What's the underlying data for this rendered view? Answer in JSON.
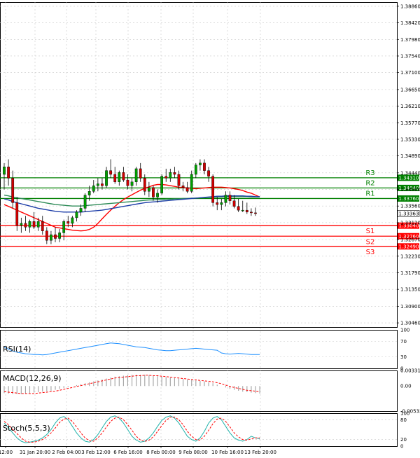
{
  "chart_data": {
    "type": "candlestick",
    "price_axis": {
      "ticks": [
        "1.38860",
        "1.38420",
        "1.37980",
        "1.37540",
        "1.37100",
        "1.36650",
        "1.36210",
        "1.35770",
        "1.35330",
        "1.34890",
        "1.34440",
        "1.34000",
        "1.33560",
        "1.33120",
        "1.32670",
        "1.32230",
        "1.31790",
        "1.31350",
        "1.30900",
        "1.30460"
      ],
      "ylim": [
        1.3035,
        1.3897
      ]
    },
    "time_axis": {
      "ticks": [
        "12:00",
        "31 Jan 20:00",
        "2 Feb 04:00",
        "3 Feb 12:00",
        "6 Feb 16:00",
        "8 Feb 00:00",
        "9 Feb 08:00",
        "10 Feb 16:00",
        "13 Feb 20:00"
      ]
    },
    "candles": [
      [
        1.344,
        1.347,
        1.34,
        1.346
      ],
      [
        1.346,
        1.348,
        1.341,
        1.343
      ],
      [
        1.343,
        1.345,
        1.335,
        1.3365
      ],
      [
        1.3365,
        1.338,
        1.329,
        1.3305
      ],
      [
        1.3305,
        1.3325,
        1.3285,
        1.331
      ],
      [
        1.331,
        1.333,
        1.329,
        1.33
      ],
      [
        1.33,
        1.332,
        1.3285,
        1.3315
      ],
      [
        1.3315,
        1.334,
        1.3295,
        1.33
      ],
      [
        1.33,
        1.3325,
        1.329,
        1.3315
      ],
      [
        1.3315,
        1.333,
        1.328,
        1.329
      ],
      [
        1.329,
        1.33,
        1.3255,
        1.3265
      ],
      [
        1.3265,
        1.329,
        1.3255,
        1.328
      ],
      [
        1.328,
        1.33,
        1.326,
        1.327
      ],
      [
        1.327,
        1.3295,
        1.326,
        1.3285
      ],
      [
        1.3285,
        1.332,
        1.3265,
        1.3315
      ],
      [
        1.3315,
        1.333,
        1.33,
        1.331
      ],
      [
        1.331,
        1.333,
        1.33,
        1.3325
      ],
      [
        1.3325,
        1.3345,
        1.3315,
        1.334
      ],
      [
        1.334,
        1.336,
        1.333,
        1.335
      ],
      [
        1.335,
        1.339,
        1.334,
        1.3385
      ],
      [
        1.3385,
        1.341,
        1.337,
        1.3395
      ],
      [
        1.3395,
        1.3425,
        1.339,
        1.341
      ],
      [
        1.341,
        1.343,
        1.3395,
        1.3415
      ],
      [
        1.3415,
        1.343,
        1.34,
        1.341
      ],
      [
        1.341,
        1.346,
        1.3405,
        1.345
      ],
      [
        1.345,
        1.348,
        1.343,
        1.344
      ],
      [
        1.344,
        1.346,
        1.3415,
        1.342
      ],
      [
        1.342,
        1.345,
        1.341,
        1.3445
      ],
      [
        1.3445,
        1.346,
        1.342,
        1.3425
      ],
      [
        1.3425,
        1.344,
        1.34,
        1.341
      ],
      [
        1.341,
        1.343,
        1.3395,
        1.342
      ],
      [
        1.342,
        1.346,
        1.341,
        1.3455
      ],
      [
        1.3455,
        1.347,
        1.342,
        1.343
      ],
      [
        1.343,
        1.344,
        1.3385,
        1.3395
      ],
      [
        1.3395,
        1.342,
        1.338,
        1.3405
      ],
      [
        1.3405,
        1.341,
        1.337,
        1.338
      ],
      [
        1.338,
        1.34,
        1.3365,
        1.339
      ],
      [
        1.339,
        1.344,
        1.3385,
        1.3435
      ],
      [
        1.3435,
        1.3455,
        1.342,
        1.343
      ],
      [
        1.343,
        1.3455,
        1.342,
        1.3445
      ],
      [
        1.3445,
        1.346,
        1.343,
        1.344
      ],
      [
        1.344,
        1.345,
        1.34,
        1.341
      ],
      [
        1.341,
        1.342,
        1.3395,
        1.3405
      ],
      [
        1.3405,
        1.342,
        1.339,
        1.3395
      ],
      [
        1.3395,
        1.345,
        1.339,
        1.344
      ],
      [
        1.344,
        1.347,
        1.343,
        1.3465
      ],
      [
        1.3465,
        1.348,
        1.345,
        1.347
      ],
      [
        1.347,
        1.348,
        1.344,
        1.345
      ],
      [
        1.345,
        1.346,
        1.342,
        1.3435
      ],
      [
        1.3435,
        1.344,
        1.3355,
        1.3365
      ],
      [
        1.3365,
        1.338,
        1.3345,
        1.336
      ],
      [
        1.336,
        1.3375,
        1.3345,
        1.3365
      ],
      [
        1.3365,
        1.3395,
        1.3355,
        1.3385
      ],
      [
        1.3385,
        1.3395,
        1.336,
        1.337
      ],
      [
        1.337,
        1.3385,
        1.335,
        1.3355
      ],
      [
        1.3355,
        1.3375,
        1.334,
        1.3345
      ],
      [
        1.3345,
        1.337,
        1.334,
        1.3345
      ],
      [
        1.3345,
        1.3365,
        1.3335,
        1.334
      ],
      [
        1.334,
        1.335,
        1.333,
        1.3338
      ],
      [
        1.3338,
        1.3352,
        1.333,
        1.3336
      ]
    ],
    "moving_averages": [
      {
        "color": "#ff0000",
        "values": [
          1.336,
          1.3355,
          1.335,
          1.3345,
          1.334,
          1.3335,
          1.333,
          1.3325,
          1.332,
          1.3315,
          1.331,
          1.3305,
          1.33,
          1.3298,
          1.3296,
          1.3294,
          1.3292,
          1.3291,
          1.329,
          1.3291,
          1.3294,
          1.33,
          1.331,
          1.3322,
          1.3334,
          1.3345,
          1.3355,
          1.3365,
          1.3373,
          1.338,
          1.3386,
          1.3392,
          1.3398,
          1.3403,
          1.3407,
          1.3411,
          1.3413,
          1.3413,
          1.3412,
          1.341,
          1.3408,
          1.3406,
          1.3405,
          1.3404,
          1.3403,
          1.3402,
          1.3403,
          1.3404,
          1.3405,
          1.3406,
          1.3406,
          1.3406,
          1.3405,
          1.3404,
          1.3402,
          1.34,
          1.3397,
          1.3393,
          1.339,
          1.3385,
          1.338
        ]
      },
      {
        "color": "#2e8b57",
        "values": [
          1.3385,
          1.3383,
          1.338,
          1.3378,
          1.3376,
          1.3374,
          1.3372,
          1.337,
          1.3368,
          1.3366,
          1.3364,
          1.3362,
          1.336,
          1.3359,
          1.3358,
          1.3357,
          1.3356,
          1.3356,
          1.3356,
          1.3357,
          1.3358,
          1.3359,
          1.336,
          1.3361,
          1.3362,
          1.3363,
          1.3364,
          1.3365,
          1.3366,
          1.3367,
          1.3368,
          1.3369,
          1.337,
          1.3371,
          1.3372,
          1.3372,
          1.3373,
          1.3373,
          1.3374,
          1.3374,
          1.3375,
          1.3375,
          1.3376,
          1.3376,
          1.3377,
          1.3377,
          1.3378,
          1.3378,
          1.3379,
          1.3379,
          1.338,
          1.338,
          1.3381,
          1.3381,
          1.3381,
          1.3381,
          1.3381,
          1.3381,
          1.338,
          1.338,
          1.338
        ]
      },
      {
        "color": "#1e3ea8",
        "values": [
          1.3375,
          1.3372,
          1.3368,
          1.3365,
          1.3362,
          1.3359,
          1.3356,
          1.3353,
          1.335,
          1.3348,
          1.3346,
          1.3344,
          1.3342,
          1.3341,
          1.334,
          1.334,
          1.334,
          1.334,
          1.334,
          1.3341,
          1.3342,
          1.3343,
          1.3344,
          1.3345,
          1.3347,
          1.3349,
          1.3351,
          1.3353,
          1.3355,
          1.3357,
          1.3359,
          1.3361,
          1.3363,
          1.3365,
          1.3366,
          1.3367,
          1.3368,
          1.3369,
          1.337,
          1.3371,
          1.3372,
          1.3373,
          1.3374,
          1.3375,
          1.3376,
          1.3377,
          1.3378,
          1.3379,
          1.338,
          1.3381,
          1.3382,
          1.3382,
          1.3383,
          1.3383,
          1.3383,
          1.3383,
          1.3383,
          1.3382,
          1.3382,
          1.3381,
          1.3381
        ]
      }
    ],
    "levels": [
      {
        "name": "R3",
        "value": 1.3431,
        "label": "1.34310",
        "color": "#008000"
      },
      {
        "name": "R2",
        "value": 1.3404,
        "label": "1.34040",
        "color": "#008000"
      },
      {
        "name": "R1",
        "value": 1.3376,
        "label": "1.33760",
        "color": "#008000"
      },
      {
        "name": "S1",
        "value": 1.3304,
        "label": "1.33040",
        "color": "#ff0000"
      },
      {
        "name": "S2",
        "value": 1.3276,
        "label": "1.32760",
        "color": "#ff0000"
      },
      {
        "name": "S3",
        "value": 1.3249,
        "label": "1.32490",
        "color": "#ff0000"
      }
    ],
    "current_price": {
      "value": 1.33363,
      "label": "1.33363"
    },
    "rsi": {
      "title": "RSI(14)",
      "ticks": [
        "100",
        "70",
        "30",
        "0"
      ],
      "ylim": [
        0,
        100
      ],
      "color": "#1e90ff",
      "values": [
        55,
        50,
        45,
        42,
        40,
        38,
        37,
        36,
        36,
        35,
        36,
        38,
        40,
        42,
        44,
        46,
        48,
        50,
        52,
        54,
        56,
        58,
        60,
        62,
        64,
        66,
        65,
        64,
        62,
        60,
        58,
        56,
        55,
        54,
        52,
        50,
        48,
        47,
        46,
        46,
        47,
        48,
        49,
        50,
        51,
        52,
        51,
        50,
        49,
        48,
        47,
        40,
        38,
        37,
        38,
        39,
        38,
        37,
        36,
        36,
        36
      ]
    },
    "macd": {
      "title": "MACD(12,26,9)",
      "ticks": [
        "0.003317",
        "0.00",
        "-0.005332"
      ],
      "ylim": [
        -0.005332,
        0.003317
      ],
      "hist_color": "#a0a0a0",
      "signal_color": "#ff0000",
      "histogram": [
        -0.0015,
        -0.0016,
        -0.0017,
        -0.0017,
        -0.0017,
        -0.0016,
        -0.0015,
        -0.0014,
        -0.0013,
        -0.0012,
        -0.0011,
        -0.001,
        -0.0008,
        -0.0006,
        -0.0004,
        -0.0002,
        0.0,
        0.0002,
        0.0004,
        0.0006,
        0.0008,
        0.001,
        0.0012,
        0.0014,
        0.0016,
        0.0018,
        0.002,
        0.0021,
        0.0022,
        0.0023,
        0.0024,
        0.0024,
        0.0024,
        0.0024,
        0.0023,
        0.0022,
        0.0021,
        0.002,
        0.0019,
        0.0018,
        0.0017,
        0.0016,
        0.0015,
        0.0014,
        0.0013,
        0.0012,
        0.0011,
        0.001,
        0.0008,
        0.0006,
        0.0003,
        0.0,
        -0.0003,
        -0.0006,
        -0.0008,
        -0.001,
        -0.0012,
        -0.0013,
        -0.0014,
        -0.0015,
        -0.0016
      ],
      "signal": [
        -0.0012,
        -0.0013,
        -0.0014,
        -0.0015,
        -0.0016,
        -0.0016,
        -0.0016,
        -0.0016,
        -0.0015,
        -0.0014,
        -0.0013,
        -0.0012,
        -0.0011,
        -0.0009,
        -0.0007,
        -0.0005,
        -0.0003,
        -0.0001,
        0.0001,
        0.0003,
        0.0005,
        0.0007,
        0.0009,
        0.0011,
        0.0013,
        0.0015,
        0.0017,
        0.0018,
        0.0019,
        0.002,
        0.0021,
        0.0022,
        0.0022,
        0.0023,
        0.0023,
        0.0022,
        0.0022,
        0.0021,
        0.002,
        0.0019,
        0.0018,
        0.0017,
        0.0016,
        0.0015,
        0.0014,
        0.0013,
        0.0012,
        0.0011,
        0.001,
        0.0009,
        0.0007,
        0.0005,
        0.0002,
        -0.0001,
        -0.0003,
        -0.0005,
        -0.0007,
        -0.0009,
        -0.001,
        -0.0011,
        -0.0012
      ]
    },
    "stoch": {
      "title": "Stoch(5,5,3)",
      "ticks": [
        "100",
        "80",
        "20",
        "0"
      ],
      "ylim": [
        0,
        100
      ],
      "k_color": "#20b2aa",
      "d_color": "#ff0000",
      "k": [
        70,
        55,
        40,
        25,
        15,
        10,
        12,
        15,
        18,
        25,
        35,
        50,
        70,
        85,
        90,
        80,
        60,
        40,
        25,
        15,
        12,
        20,
        35,
        55,
        75,
        88,
        92,
        85,
        70,
        50,
        30,
        18,
        12,
        15,
        25,
        40,
        60,
        78,
        88,
        92,
        85,
        70,
        50,
        30,
        20,
        15,
        25,
        45,
        70,
        85,
        90,
        80,
        60,
        40,
        25,
        18,
        15,
        20,
        30,
        25,
        22
      ],
      "d": [
        75,
        65,
        50,
        38,
        25,
        15,
        12,
        12,
        15,
        20,
        28,
        40,
        55,
        72,
        82,
        85,
        75,
        58,
        40,
        25,
        16,
        15,
        25,
        40,
        58,
        75,
        85,
        88,
        80,
        65,
        48,
        30,
        18,
        14,
        18,
        28,
        45,
        62,
        78,
        88,
        88,
        80,
        65,
        45,
        30,
        20,
        18,
        30,
        48,
        68,
        82,
        85,
        75,
        58,
        40,
        28,
        20,
        18,
        22,
        25,
        25
      ]
    }
  }
}
